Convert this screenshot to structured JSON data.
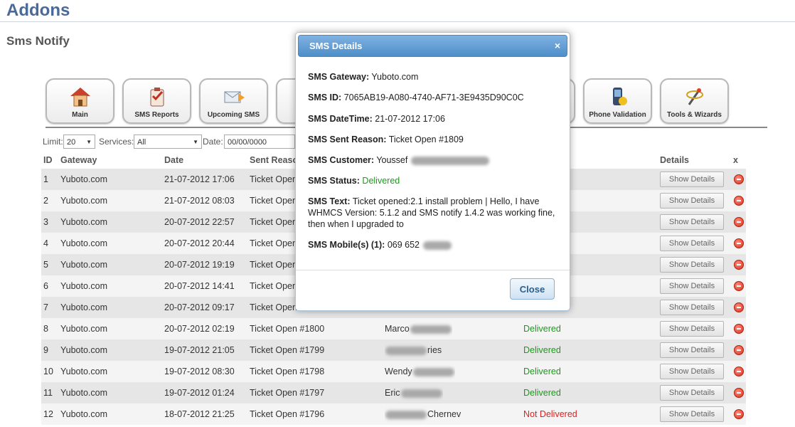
{
  "header": {
    "title": "Addons",
    "subtitle": "Sms Notify"
  },
  "toolbar": {
    "buttons": [
      {
        "label": "Main",
        "icon": "house-icon"
      },
      {
        "label": "SMS Reports",
        "icon": "clipboard-check-icon"
      },
      {
        "label": "Upcoming SMS",
        "icon": "envelope-clock-icon"
      },
      {
        "label": "",
        "icon": "hidden-button"
      },
      {
        "label": "",
        "icon": "hidden-button"
      },
      {
        "label": "",
        "icon": "hidden-button"
      },
      {
        "label": "",
        "icon": "hidden-button"
      },
      {
        "label": "Phone Validation",
        "icon": "phone-check-icon"
      },
      {
        "label": "Tools & Wizards",
        "icon": "tools-wand-icon"
      }
    ]
  },
  "filters": {
    "limit_label": "Limit:",
    "limit_value": "20",
    "services_label": "Services:",
    "services_value": "All",
    "date_label": "Date:",
    "date_value": "00/00/0000"
  },
  "table": {
    "headers": {
      "id": "ID",
      "gateway": "Gateway",
      "date": "Date",
      "reason": "Sent Reaso",
      "details": "Details",
      "x": "x"
    },
    "button_label": "Show Details",
    "rows": [
      {
        "id": "1",
        "gateway": "Yuboto.com",
        "date": "21-07-2012 17:06",
        "reason": "Ticket Open",
        "customer_pre": "",
        "customer_post": "",
        "status": "",
        "ok": true
      },
      {
        "id": "2",
        "gateway": "Yuboto.com",
        "date": "21-07-2012 08:03",
        "reason": "Ticket Open",
        "customer_pre": "",
        "customer_post": "",
        "status": "",
        "ok": true
      },
      {
        "id": "3",
        "gateway": "Yuboto.com",
        "date": "20-07-2012 22:57",
        "reason": "Ticket Open",
        "customer_pre": "",
        "customer_post": "",
        "status": "",
        "ok": true
      },
      {
        "id": "4",
        "gateway": "Yuboto.com",
        "date": "20-07-2012 20:44",
        "reason": "Ticket Open",
        "customer_pre": "",
        "customer_post": "",
        "status": "",
        "ok": true
      },
      {
        "id": "5",
        "gateway": "Yuboto.com",
        "date": "20-07-2012 19:19",
        "reason": "Ticket Open",
        "customer_pre": "",
        "customer_post": "",
        "status": "",
        "ok": true
      },
      {
        "id": "6",
        "gateway": "Yuboto.com",
        "date": "20-07-2012 14:41",
        "reason": "Ticket Open",
        "customer_pre": "",
        "customer_post": "",
        "status": "",
        "ok": true
      },
      {
        "id": "7",
        "gateway": "Yuboto.com",
        "date": "20-07-2012 09:17",
        "reason": "Ticket Open",
        "customer_pre": "",
        "customer_post": "",
        "status": "",
        "ok": true
      },
      {
        "id": "8",
        "gateway": "Yuboto.com",
        "date": "20-07-2012 02:19",
        "reason": "Ticket Open #1800",
        "customer_pre": "Marco",
        "customer_post": "",
        "status": "Delivered",
        "ok": true
      },
      {
        "id": "9",
        "gateway": "Yuboto.com",
        "date": "19-07-2012 21:05",
        "reason": "Ticket Open #1799",
        "customer_pre": "",
        "customer_post": "ries",
        "status": "Delivered",
        "ok": true
      },
      {
        "id": "10",
        "gateway": "Yuboto.com",
        "date": "19-07-2012 08:30",
        "reason": "Ticket Open #1798",
        "customer_pre": "Wendy",
        "customer_post": "",
        "status": "Delivered",
        "ok": true
      },
      {
        "id": "11",
        "gateway": "Yuboto.com",
        "date": "19-07-2012 01:24",
        "reason": "Ticket Open #1797",
        "customer_pre": "Eric",
        "customer_post": "",
        "status": "Delivered",
        "ok": true
      },
      {
        "id": "12",
        "gateway": "Yuboto.com",
        "date": "18-07-2012 21:25",
        "reason": "Ticket Open #1796",
        "customer_pre": "",
        "customer_post": "Chernev",
        "status": "Not Delivered",
        "ok": false
      }
    ]
  },
  "modal": {
    "title": "SMS Details",
    "close_x": "×",
    "gateway_label": "SMS Gateway:",
    "gateway_value": "Yuboto.com",
    "id_label": "SMS ID:",
    "id_value": "7065AB19-A080-4740-AF71-3E9435D90C0C",
    "datetime_label": "SMS DateTime:",
    "datetime_value": "21-07-2012 17:06",
    "reason_label": "SMS Sent Reason:",
    "reason_value": "Ticket Open #1809",
    "customer_label": "SMS Customer:",
    "customer_value": "Youssef",
    "status_label": "SMS Status:",
    "status_value": "Delivered",
    "text_label": "SMS Text:",
    "text_value": "Ticket opened:2.1 install problem | Hello, I have WHMCS Version: 5.1.2 and SMS notify 1.4.2 was working fine, then when I upgraded to",
    "mobile_label": "SMS Mobile(s) (1):",
    "mobile_value": "069 652",
    "close_label": "Close"
  }
}
